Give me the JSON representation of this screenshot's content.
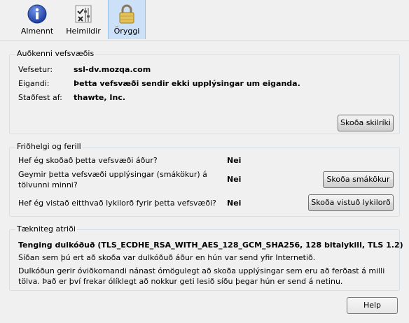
{
  "tabs": [
    {
      "label": "Almennt",
      "icon": "info-icon",
      "active": false
    },
    {
      "label": "Heimildir",
      "icon": "permissions-icon",
      "active": false
    },
    {
      "label": "Öryggi",
      "icon": "lock-icon",
      "active": true
    }
  ],
  "identity": {
    "title": "Auðkenni vefsvæðis",
    "website_label": "Vefsetur:",
    "website_value": "ssl-dv.mozqa.com",
    "owner_label": "Eigandi:",
    "owner_value": "Þetta vefsvæði sendir ekki upplýsingar um eiganda.",
    "verified_label": "Staðfest af:",
    "verified_value": "thawte, Inc.",
    "view_cert_button": "Skoða skilríki"
  },
  "privacy": {
    "title": "Friðhelgi og ferill",
    "visited_question": "Hef ég skoðað þetta vefsvæði áður?",
    "visited_answer": "Nei",
    "cookies_question_line1": "Geymir þetta vefsvæði upplýsingar (smákökur) á",
    "cookies_question_line2": "tölvunni minni?",
    "cookies_answer": "Nei",
    "cookies_button": "Skoða smákökur",
    "passwords_question": "Hef ég vistað eitthvað lykilorð fyrir þetta vefsvæði?",
    "passwords_answer": "Nei",
    "passwords_button": "Skoða vistuð lykilorð"
  },
  "technical": {
    "title": "Tækniteg atriði",
    "connection": "Tenging dulkóðuð (TLS_ECDHE_RSA_WITH_AES_128_GCM_SHA256, 128 bitalykill, TLS 1.2)",
    "line1": "Síðan sem þú ert að skoða var dulkóðuð áður en hún var send yfir Internetið.",
    "line2": "Dulkóðun gerir óviðkomandi nánast ómögulegt að skoða upplýsingar sem eru að ferðast á milli",
    "line3": "tölva. Það er því frekar ólíklegt að nokkur geti lesið síðu þegar hún er send á netinu."
  },
  "footer": {
    "help_button": "Help"
  }
}
